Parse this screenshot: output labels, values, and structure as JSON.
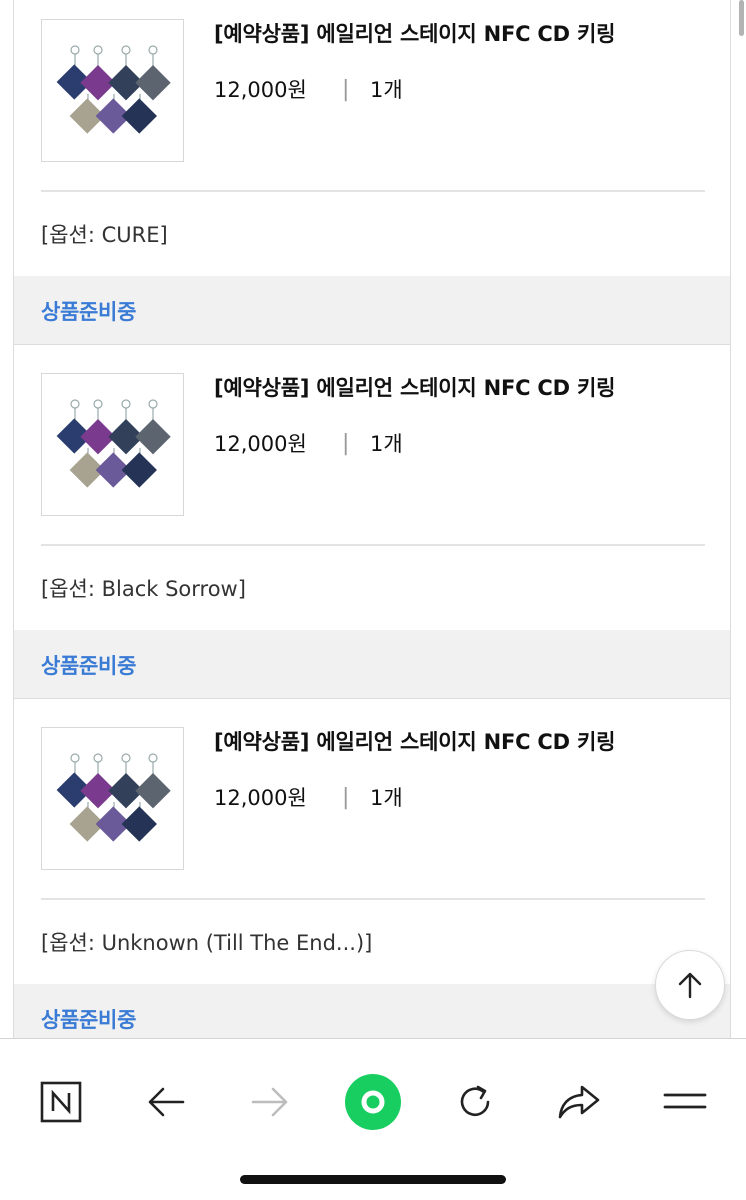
{
  "orders": [
    {
      "product_name": "[예약상품] 에일리언 스테이지 NFC CD 키링",
      "price": "12,000원",
      "separator": "|",
      "quantity": "1개",
      "option": "[옵션: CURE]",
      "status": "상품준비중"
    },
    {
      "product_name": "[예약상품] 에일리언 스테이지 NFC CD 키링",
      "price": "12,000원",
      "separator": "|",
      "quantity": "1개",
      "option": "[옵션: Black Sorrow]",
      "status": "상품준비중"
    },
    {
      "product_name": "[예약상품] 에일리언 스테이지 NFC CD 키링",
      "price": "12,000원",
      "separator": "|",
      "quantity": "1개",
      "option": "[옵션: Unknown (Till The End...)]",
      "status": "상품준비중"
    }
  ],
  "scroll_top_button": {
    "icon": "arrow-up-icon"
  },
  "browser_toolbar": {
    "items": [
      {
        "icon": "naver-n-icon"
      },
      {
        "icon": "back-arrow-icon"
      },
      {
        "icon": "forward-arrow-icon",
        "state": "disabled"
      },
      {
        "icon": "green-circle-home-icon"
      },
      {
        "icon": "reload-icon"
      },
      {
        "icon": "share-icon"
      },
      {
        "icon": "menu-icon"
      }
    ]
  },
  "colors": {
    "status_text": "#3a7bd5",
    "status_bg": "#f1f1f1",
    "accent_green": "#19ce60"
  }
}
